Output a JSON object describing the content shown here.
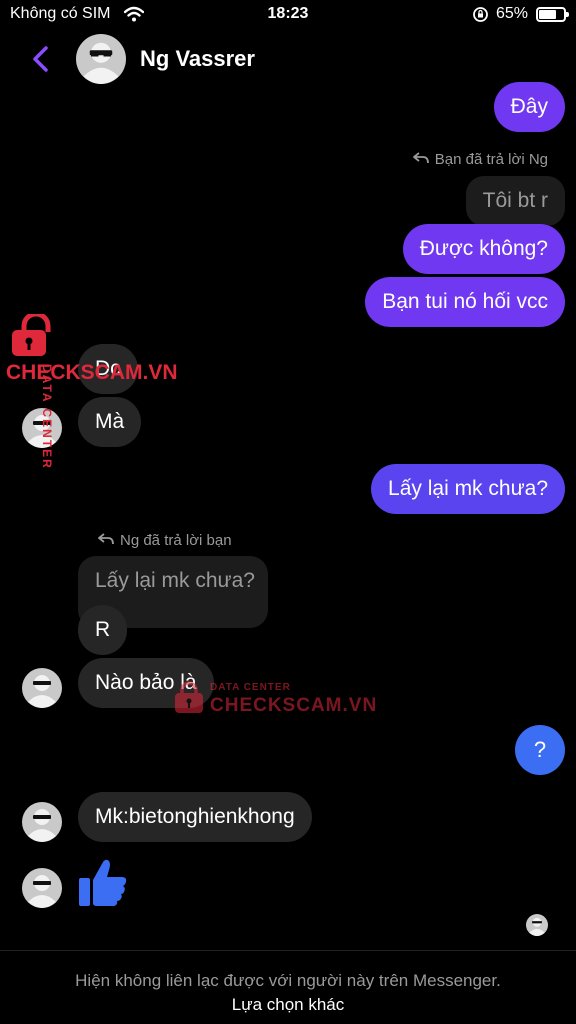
{
  "status_bar": {
    "carrier": "Không có SIM",
    "time": "18:23",
    "battery": "65%",
    "battery_level": 0.65
  },
  "header": {
    "contact_name": "Ng Vassrer"
  },
  "messages": {
    "m1": "Đây",
    "reply_note_outgoing": "Bạn đã trả lời Ng",
    "quoted_outgoing": "Tôi bt r",
    "m2": "Được không?",
    "m3": "Bạn tui nó hối vcc",
    "m4": "Dc",
    "m5": "Mà",
    "m6": "Lấy lại mk chưa?",
    "reply_note_incoming": "Ng đã trả lời bạn",
    "quoted_incoming": "Lấy lại mk chưa?",
    "m7": "R",
    "m8": "Nào bảo là",
    "m9": "?",
    "m10": "Mk:bietonghienkhong"
  },
  "watermark": {
    "brand": "CHECKSCAM.VN",
    "tagline": "DATA CENTER"
  },
  "footer": {
    "notice": "Hiện không liên lạc được với người này trên Messenger.",
    "action": "Lựa chọn khác"
  },
  "colors": {
    "outgoing_bubble": "#7038f0",
    "incoming_bubble": "#262626",
    "accent": "#8a4dff",
    "like_blue": "#3b6ef2",
    "watermark_red": "#e0283b"
  }
}
